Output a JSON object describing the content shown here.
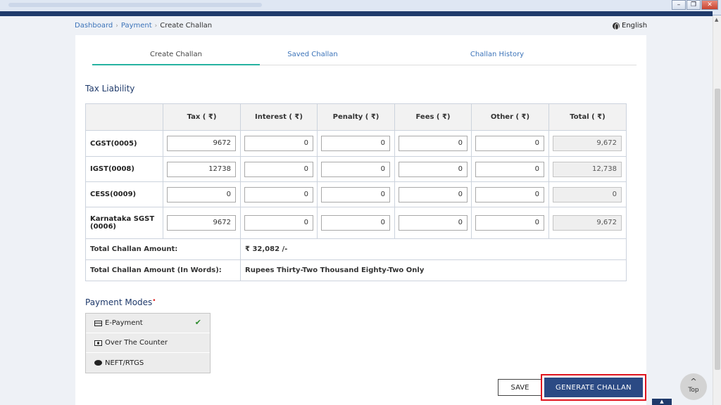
{
  "window": {
    "minimize": "–",
    "restore": "❐",
    "close": "✕"
  },
  "breadcrumb": {
    "items": [
      "Dashboard",
      "Payment"
    ],
    "current": "Create Challan",
    "separator": "›"
  },
  "language": "English",
  "tabs": [
    {
      "label": "Create Challan",
      "active": true
    },
    {
      "label": "Saved Challan",
      "active": false
    },
    {
      "label": "Challan History",
      "active": false
    }
  ],
  "tax_liability": {
    "title": "Tax Liability",
    "columns": [
      "",
      "Tax ( ₹)",
      "Interest ( ₹)",
      "Penalty ( ₹)",
      "Fees ( ₹)",
      "Other ( ₹)",
      "Total ( ₹)"
    ],
    "rows": [
      {
        "label": "CGST(0005)",
        "tax": "9672",
        "interest": "0",
        "penalty": "0",
        "fees": "0",
        "other": "0",
        "total": "9,672"
      },
      {
        "label": "IGST(0008)",
        "tax": "12738",
        "interest": "0",
        "penalty": "0",
        "fees": "0",
        "other": "0",
        "total": "12,738"
      },
      {
        "label": "CESS(0009)",
        "tax": "0",
        "interest": "0",
        "penalty": "0",
        "fees": "0",
        "other": "0",
        "total": "0"
      },
      {
        "label": "Karnataka SGST (0006)",
        "tax": "9672",
        "interest": "0",
        "penalty": "0",
        "fees": "0",
        "other": "0",
        "total": "9,672"
      }
    ],
    "total_amount_label": "Total Challan Amount:",
    "total_amount_value": "₹ 32,082 /-",
    "total_words_label": "Total Challan Amount (In Words):",
    "total_words_value": "Rupees Thirty-Two Thousand Eighty-Two Only"
  },
  "payment_modes": {
    "title": "Payment Modes",
    "required_mark": "•",
    "options": [
      {
        "label": "E-Payment",
        "icon": "card-icon",
        "selected": true
      },
      {
        "label": "Over The Counter",
        "icon": "cash-icon",
        "selected": false
      },
      {
        "label": "NEFT/RTGS",
        "icon": "globe-icon",
        "selected": false
      }
    ],
    "check_glyph": "✔"
  },
  "actions": {
    "save": "SAVE",
    "generate": "GENERATE CHALLAN"
  },
  "top_button": {
    "label": "Top",
    "glyph": "^"
  },
  "corner_button": {
    "glyph": "▲"
  },
  "colors": {
    "navy": "#1f3a6b",
    "link": "#3b73b9",
    "accent_tab": "#27b3a1",
    "button": "#2b4a84",
    "highlight": "#e0141e",
    "check": "#2e8b2e"
  }
}
